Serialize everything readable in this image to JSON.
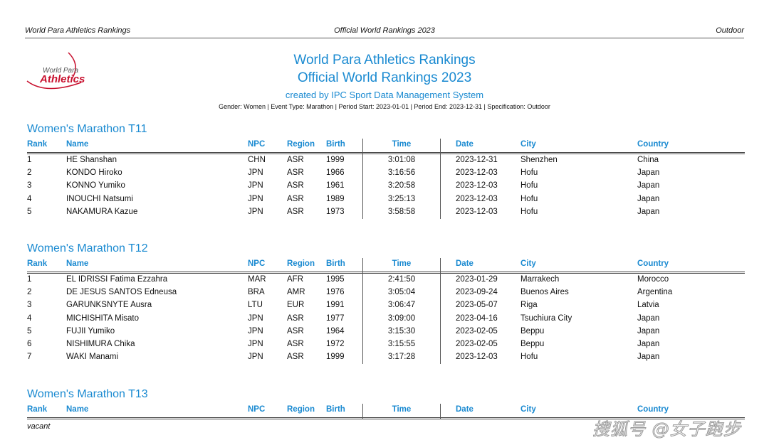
{
  "header": {
    "left": "World Para Athletics Rankings",
    "center": "Official World Rankings 2023",
    "right": "Outdoor"
  },
  "logo": {
    "line1": "World Para",
    "line2": "Athletics"
  },
  "title": {
    "line1": "World Para Athletics Rankings",
    "line2": "Official World Rankings 2023",
    "created": "created by IPC Sport Data Management System",
    "meta": "Gender: Women | Event Type: Marathon | Period Start: 2023-01-01 | Period End: 2023-12-31 | Specification: Outdoor"
  },
  "columns": [
    "Rank",
    "Name",
    "NPC",
    "Region",
    "Birth",
    "Time",
    "Date",
    "City",
    "Country"
  ],
  "sections": [
    {
      "title": "Women's Marathon T11",
      "rows": [
        [
          "1",
          "HE Shanshan",
          "CHN",
          "ASR",
          "1999",
          "3:01:08",
          "2023-12-31",
          "Shenzhen",
          "China"
        ],
        [
          "2",
          "KONDO Hiroko",
          "JPN",
          "ASR",
          "1966",
          "3:16:56",
          "2023-12-03",
          "Hofu",
          "Japan"
        ],
        [
          "3",
          "KONNO Yumiko",
          "JPN",
          "ASR",
          "1961",
          "3:20:58",
          "2023-12-03",
          "Hofu",
          "Japan"
        ],
        [
          "4",
          "INOUCHI Natsumi",
          "JPN",
          "ASR",
          "1989",
          "3:25:13",
          "2023-12-03",
          "Hofu",
          "Japan"
        ],
        [
          "5",
          "NAKAMURA Kazue",
          "JPN",
          "ASR",
          "1973",
          "3:58:58",
          "2023-12-03",
          "Hofu",
          "Japan"
        ]
      ]
    },
    {
      "title": "Women's Marathon T12",
      "rows": [
        [
          "1",
          "EL IDRISSI Fatima Ezzahra",
          "MAR",
          "AFR",
          "1995",
          "2:41:50",
          "2023-01-29",
          "Marrakech",
          "Morocco"
        ],
        [
          "2",
          "DE JESUS SANTOS Edneusa",
          "BRA",
          "AMR",
          "1976",
          "3:05:04",
          "2023-09-24",
          "Buenos Aires",
          "Argentina"
        ],
        [
          "3",
          "GARUNKSNYTE Ausra",
          "LTU",
          "EUR",
          "1991",
          "3:06:47",
          "2023-05-07",
          "Riga",
          "Latvia"
        ],
        [
          "4",
          "MICHISHITA Misato",
          "JPN",
          "ASR",
          "1977",
          "3:09:00",
          "2023-04-16",
          "Tsuchiura City",
          "Japan"
        ],
        [
          "5",
          "FUJII Yumiko",
          "JPN",
          "ASR",
          "1964",
          "3:15:30",
          "2023-02-05",
          "Beppu",
          "Japan"
        ],
        [
          "6",
          "NISHIMURA Chika",
          "JPN",
          "ASR",
          "1972",
          "3:15:55",
          "2023-02-05",
          "Beppu",
          "Japan"
        ],
        [
          "7",
          "WAKI Manami",
          "JPN",
          "ASR",
          "1999",
          "3:17:28",
          "2023-12-03",
          "Hofu",
          "Japan"
        ]
      ]
    },
    {
      "title": "Women's Marathon T13",
      "rows": [],
      "empty": "vacant"
    }
  ],
  "watermark": "搜狐号 @女子跑步"
}
